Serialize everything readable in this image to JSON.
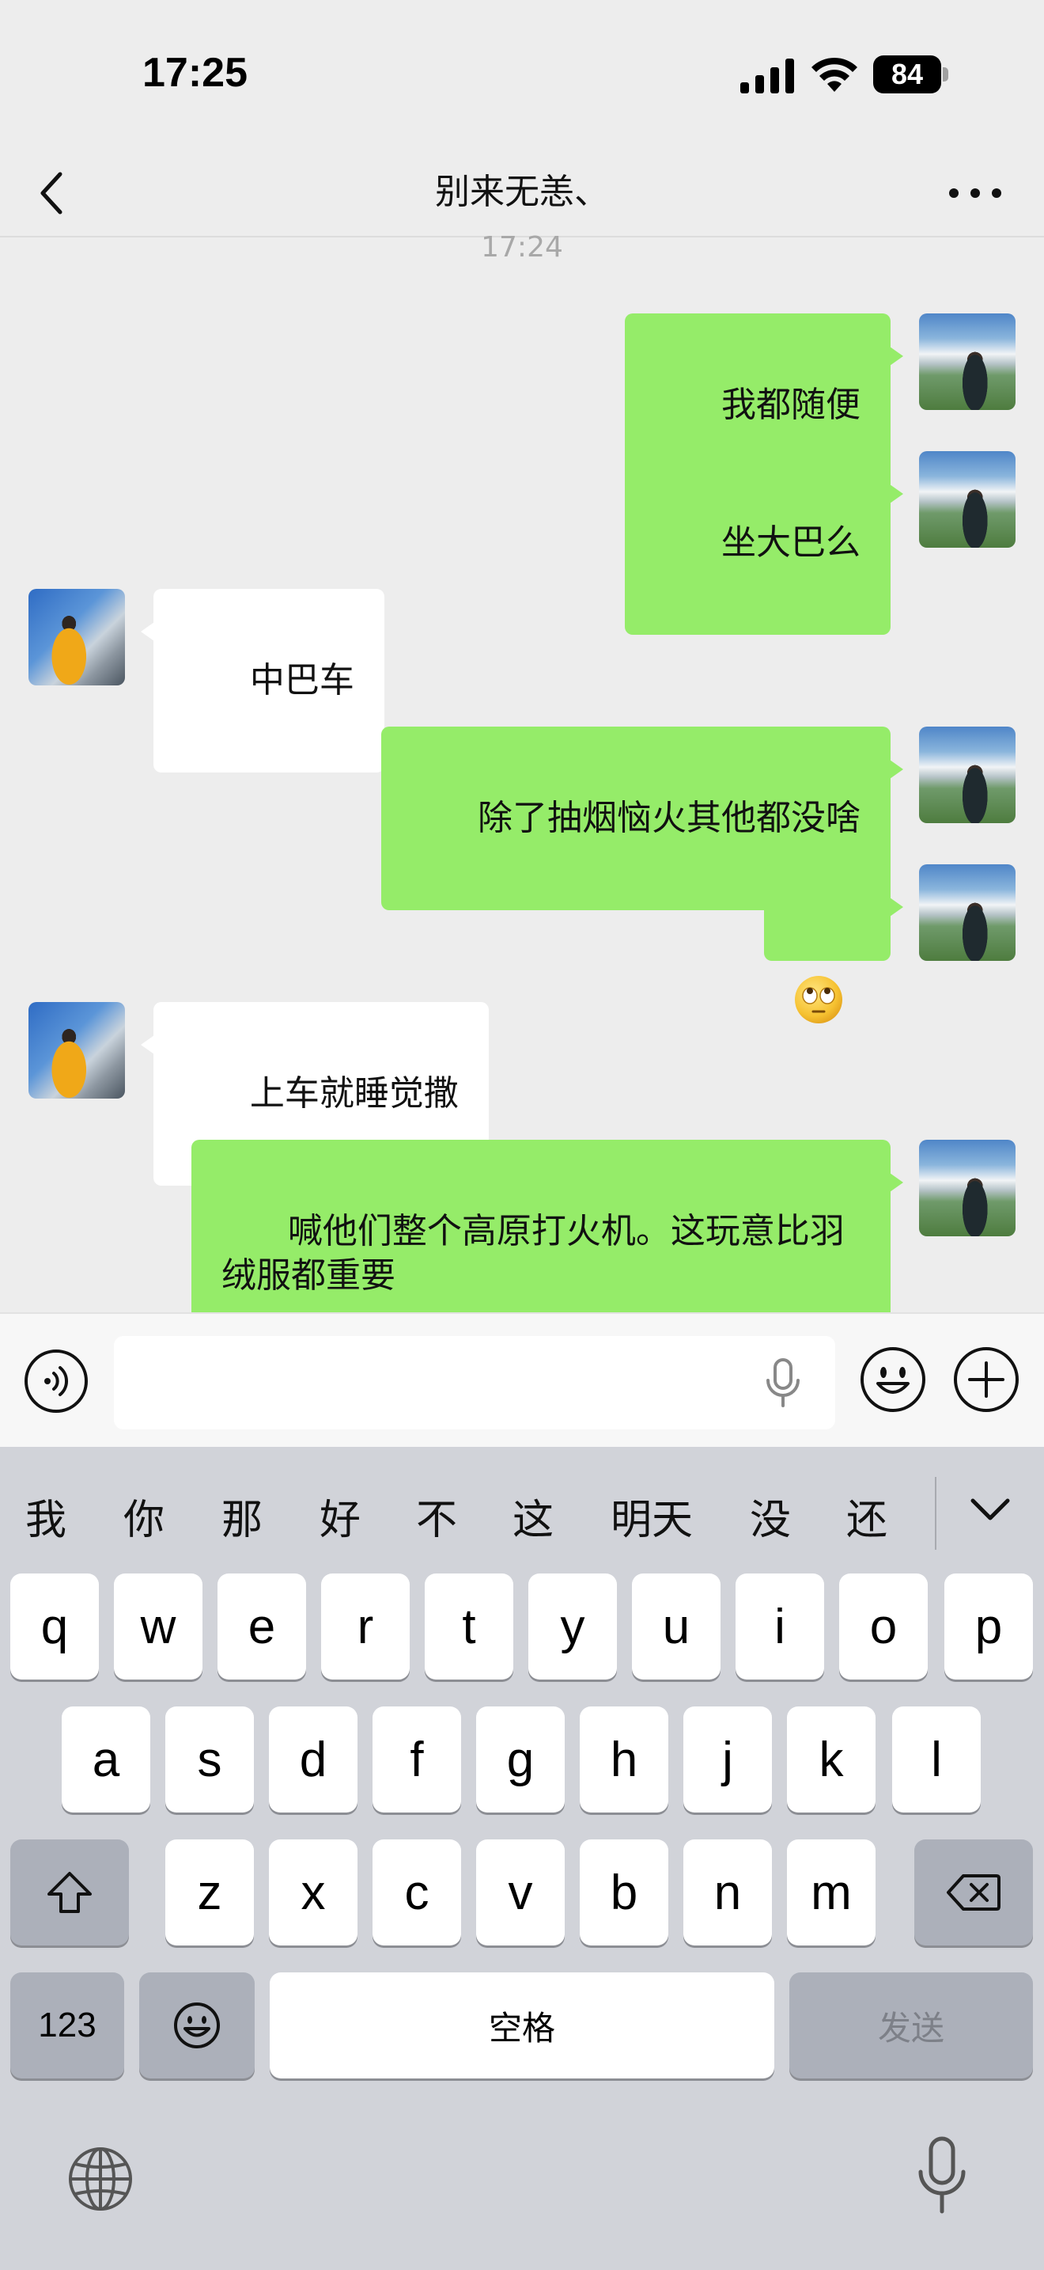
{
  "status_bar": {
    "time": "17:25",
    "battery": "84"
  },
  "header": {
    "title": "别来无恙、"
  },
  "conversation": {
    "timestamp": "17:24",
    "messages": [
      {
        "from": "me",
        "text": "我都随便"
      },
      {
        "from": "me",
        "text": "坐大巴么"
      },
      {
        "from": "other",
        "text": "中巴车"
      },
      {
        "from": "me",
        "text": "除了抽烟恼火其他都没啥"
      },
      {
        "from": "me",
        "text": "",
        "emoji": "rolling-eyes-emoji"
      },
      {
        "from": "other",
        "text": "上车就睡觉撒"
      },
      {
        "from": "me",
        "text": "喊他们整个高原打火机。这玩意比羽\n绒服都重要"
      }
    ]
  },
  "input": {
    "value": ""
  },
  "keyboard": {
    "candidates": [
      "我",
      "你",
      "那",
      "好",
      "不",
      "这",
      "明天",
      "没",
      "还"
    ],
    "row1": [
      "q",
      "w",
      "e",
      "r",
      "t",
      "y",
      "u",
      "i",
      "o",
      "p"
    ],
    "row2": [
      "a",
      "s",
      "d",
      "f",
      "g",
      "h",
      "j",
      "k",
      "l"
    ],
    "row3": [
      "z",
      "x",
      "c",
      "v",
      "b",
      "n",
      "m"
    ],
    "numbers_label": "123",
    "space_label": "空格",
    "send_label": "发送"
  },
  "colors": {
    "sent_bubble": "#95ec69",
    "received_bubble": "#ffffff",
    "background": "#ededed",
    "keyboard": "#d1d3d9"
  }
}
